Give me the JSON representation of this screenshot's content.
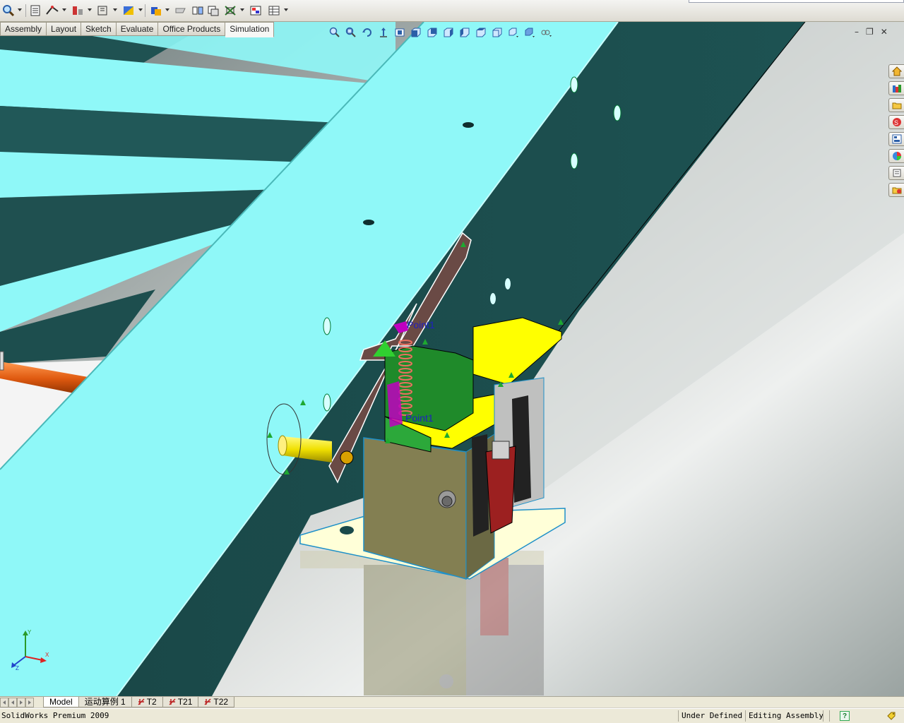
{
  "app": {
    "name": "SolidWorks Premium 2009"
  },
  "toolbar": {
    "icons": [
      "zoom-icon",
      "bom-icon",
      "mate-icon",
      "assembly-features-icon",
      "reference-geometry-icon",
      "color-icon",
      "hide-show-icon",
      "section-icon",
      "explode-icon",
      "instant3d-icon",
      "table-icon"
    ]
  },
  "command_tabs": [
    {
      "label": "Assembly",
      "active": false
    },
    {
      "label": "Layout",
      "active": false
    },
    {
      "label": "Sketch",
      "active": false
    },
    {
      "label": "Evaluate",
      "active": false
    },
    {
      "label": "Office Products",
      "active": false
    },
    {
      "label": "Simulation",
      "active": true
    }
  ],
  "heads_up_toolbar": {
    "icons": [
      "zoom-to-fit-icon",
      "zoom-to-area-icon",
      "rotate-icon",
      "pan-icon",
      "previous-view-icon",
      "front-view-icon",
      "back-view-icon",
      "left-view-icon",
      "right-view-icon",
      "top-view-icon",
      "isometric-view-icon",
      "view-orientation-icon",
      "display-style-icon",
      "hide-show-items-icon"
    ]
  },
  "window_controls": {
    "minimize": "–",
    "restore": "❐",
    "close": "✕"
  },
  "task_pane": {
    "icons": [
      "home-icon",
      "design-library-icon",
      "file-explorer-icon",
      "solidworks-search-icon",
      "view-palette-icon",
      "appearances-icon",
      "custom-properties-icon",
      "document-recovery-icon"
    ]
  },
  "viewport": {
    "labels": {
      "point_upper": "Point1",
      "point_lower": "Point1"
    },
    "colors": {
      "frame_top": "#8ff8f8",
      "frame_side": "#1a4a4a",
      "bracket_yellow": "#ffff00",
      "bracket_green": "#1f8a2a",
      "spring_color": "#e87060",
      "motor_point": "#c000c0"
    }
  },
  "triad": {
    "x": "X",
    "y": "Y",
    "z": "Z"
  },
  "bottom_tabs": [
    {
      "label": "Model",
      "active": true,
      "motion": false
    },
    {
      "label": "运动算例 1",
      "active": false,
      "motion": false
    },
    {
      "label": "T2",
      "active": false,
      "motion": true
    },
    {
      "label": "T21",
      "active": false,
      "motion": true
    },
    {
      "label": "T22",
      "active": false,
      "motion": true
    }
  ],
  "status_bar": {
    "left": "SolidWorks Premium 2009",
    "definition": "Under Defined",
    "mode": "Editing Assembly",
    "help": "?"
  }
}
